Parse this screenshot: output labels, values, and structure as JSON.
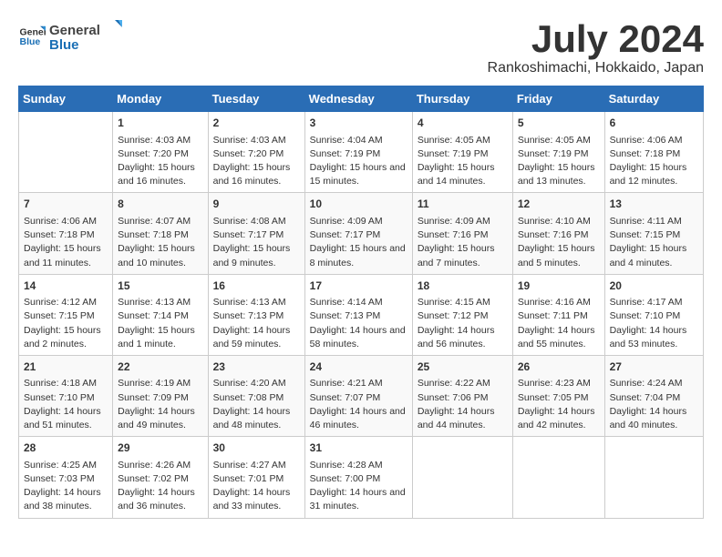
{
  "header": {
    "logo_general": "General",
    "logo_blue": "Blue",
    "title": "July 2024",
    "subtitle": "Rankoshimachi, Hokkaido, Japan"
  },
  "calendar": {
    "days_of_week": [
      "Sunday",
      "Monday",
      "Tuesday",
      "Wednesday",
      "Thursday",
      "Friday",
      "Saturday"
    ],
    "weeks": [
      [
        {
          "day": "",
          "sunrise": "",
          "sunset": "",
          "daylight": ""
        },
        {
          "day": "1",
          "sunrise": "Sunrise: 4:03 AM",
          "sunset": "Sunset: 7:20 PM",
          "daylight": "Daylight: 15 hours and 16 minutes."
        },
        {
          "day": "2",
          "sunrise": "Sunrise: 4:03 AM",
          "sunset": "Sunset: 7:20 PM",
          "daylight": "Daylight: 15 hours and 16 minutes."
        },
        {
          "day": "3",
          "sunrise": "Sunrise: 4:04 AM",
          "sunset": "Sunset: 7:19 PM",
          "daylight": "Daylight: 15 hours and 15 minutes."
        },
        {
          "day": "4",
          "sunrise": "Sunrise: 4:05 AM",
          "sunset": "Sunset: 7:19 PM",
          "daylight": "Daylight: 15 hours and 14 minutes."
        },
        {
          "day": "5",
          "sunrise": "Sunrise: 4:05 AM",
          "sunset": "Sunset: 7:19 PM",
          "daylight": "Daylight: 15 hours and 13 minutes."
        },
        {
          "day": "6",
          "sunrise": "Sunrise: 4:06 AM",
          "sunset": "Sunset: 7:18 PM",
          "daylight": "Daylight: 15 hours and 12 minutes."
        }
      ],
      [
        {
          "day": "7",
          "sunrise": "Sunrise: 4:06 AM",
          "sunset": "Sunset: 7:18 PM",
          "daylight": "Daylight: 15 hours and 11 minutes."
        },
        {
          "day": "8",
          "sunrise": "Sunrise: 4:07 AM",
          "sunset": "Sunset: 7:18 PM",
          "daylight": "Daylight: 15 hours and 10 minutes."
        },
        {
          "day": "9",
          "sunrise": "Sunrise: 4:08 AM",
          "sunset": "Sunset: 7:17 PM",
          "daylight": "Daylight: 15 hours and 9 minutes."
        },
        {
          "day": "10",
          "sunrise": "Sunrise: 4:09 AM",
          "sunset": "Sunset: 7:17 PM",
          "daylight": "Daylight: 15 hours and 8 minutes."
        },
        {
          "day": "11",
          "sunrise": "Sunrise: 4:09 AM",
          "sunset": "Sunset: 7:16 PM",
          "daylight": "Daylight: 15 hours and 7 minutes."
        },
        {
          "day": "12",
          "sunrise": "Sunrise: 4:10 AM",
          "sunset": "Sunset: 7:16 PM",
          "daylight": "Daylight: 15 hours and 5 minutes."
        },
        {
          "day": "13",
          "sunrise": "Sunrise: 4:11 AM",
          "sunset": "Sunset: 7:15 PM",
          "daylight": "Daylight: 15 hours and 4 minutes."
        }
      ],
      [
        {
          "day": "14",
          "sunrise": "Sunrise: 4:12 AM",
          "sunset": "Sunset: 7:15 PM",
          "daylight": "Daylight: 15 hours and 2 minutes."
        },
        {
          "day": "15",
          "sunrise": "Sunrise: 4:13 AM",
          "sunset": "Sunset: 7:14 PM",
          "daylight": "Daylight: 15 hours and 1 minute."
        },
        {
          "day": "16",
          "sunrise": "Sunrise: 4:13 AM",
          "sunset": "Sunset: 7:13 PM",
          "daylight": "Daylight: 14 hours and 59 minutes."
        },
        {
          "day": "17",
          "sunrise": "Sunrise: 4:14 AM",
          "sunset": "Sunset: 7:13 PM",
          "daylight": "Daylight: 14 hours and 58 minutes."
        },
        {
          "day": "18",
          "sunrise": "Sunrise: 4:15 AM",
          "sunset": "Sunset: 7:12 PM",
          "daylight": "Daylight: 14 hours and 56 minutes."
        },
        {
          "day": "19",
          "sunrise": "Sunrise: 4:16 AM",
          "sunset": "Sunset: 7:11 PM",
          "daylight": "Daylight: 14 hours and 55 minutes."
        },
        {
          "day": "20",
          "sunrise": "Sunrise: 4:17 AM",
          "sunset": "Sunset: 7:10 PM",
          "daylight": "Daylight: 14 hours and 53 minutes."
        }
      ],
      [
        {
          "day": "21",
          "sunrise": "Sunrise: 4:18 AM",
          "sunset": "Sunset: 7:10 PM",
          "daylight": "Daylight: 14 hours and 51 minutes."
        },
        {
          "day": "22",
          "sunrise": "Sunrise: 4:19 AM",
          "sunset": "Sunset: 7:09 PM",
          "daylight": "Daylight: 14 hours and 49 minutes."
        },
        {
          "day": "23",
          "sunrise": "Sunrise: 4:20 AM",
          "sunset": "Sunset: 7:08 PM",
          "daylight": "Daylight: 14 hours and 48 minutes."
        },
        {
          "day": "24",
          "sunrise": "Sunrise: 4:21 AM",
          "sunset": "Sunset: 7:07 PM",
          "daylight": "Daylight: 14 hours and 46 minutes."
        },
        {
          "day": "25",
          "sunrise": "Sunrise: 4:22 AM",
          "sunset": "Sunset: 7:06 PM",
          "daylight": "Daylight: 14 hours and 44 minutes."
        },
        {
          "day": "26",
          "sunrise": "Sunrise: 4:23 AM",
          "sunset": "Sunset: 7:05 PM",
          "daylight": "Daylight: 14 hours and 42 minutes."
        },
        {
          "day": "27",
          "sunrise": "Sunrise: 4:24 AM",
          "sunset": "Sunset: 7:04 PM",
          "daylight": "Daylight: 14 hours and 40 minutes."
        }
      ],
      [
        {
          "day": "28",
          "sunrise": "Sunrise: 4:25 AM",
          "sunset": "Sunset: 7:03 PM",
          "daylight": "Daylight: 14 hours and 38 minutes."
        },
        {
          "day": "29",
          "sunrise": "Sunrise: 4:26 AM",
          "sunset": "Sunset: 7:02 PM",
          "daylight": "Daylight: 14 hours and 36 minutes."
        },
        {
          "day": "30",
          "sunrise": "Sunrise: 4:27 AM",
          "sunset": "Sunset: 7:01 PM",
          "daylight": "Daylight: 14 hours and 33 minutes."
        },
        {
          "day": "31",
          "sunrise": "Sunrise: 4:28 AM",
          "sunset": "Sunset: 7:00 PM",
          "daylight": "Daylight: 14 hours and 31 minutes."
        },
        {
          "day": "",
          "sunrise": "",
          "sunset": "",
          "daylight": ""
        },
        {
          "day": "",
          "sunrise": "",
          "sunset": "",
          "daylight": ""
        },
        {
          "day": "",
          "sunrise": "",
          "sunset": "",
          "daylight": ""
        }
      ]
    ]
  }
}
